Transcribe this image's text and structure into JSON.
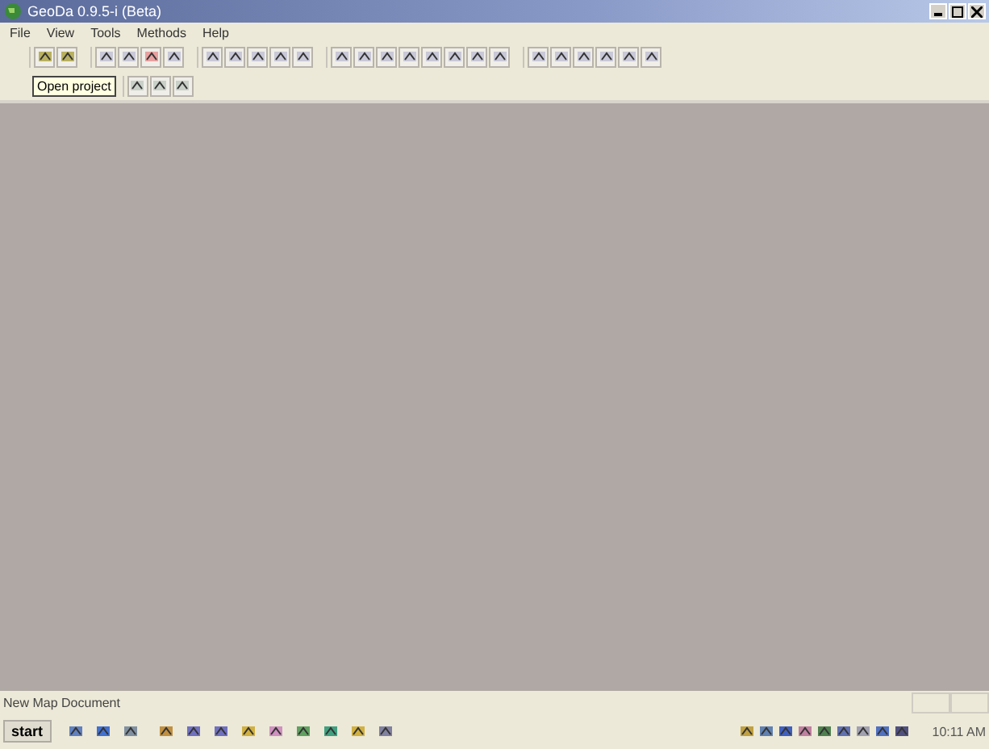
{
  "window": {
    "title": "GeoDa 0.9.5-i (Beta)"
  },
  "menu": [
    "File",
    "View",
    "Tools",
    "Methods",
    "Help"
  ],
  "tooltip": {
    "text": "Open project"
  },
  "status_bar": {
    "text": "New Map Document"
  },
  "taskbar": {
    "start": "start",
    "clock": "10:11 AM"
  }
}
